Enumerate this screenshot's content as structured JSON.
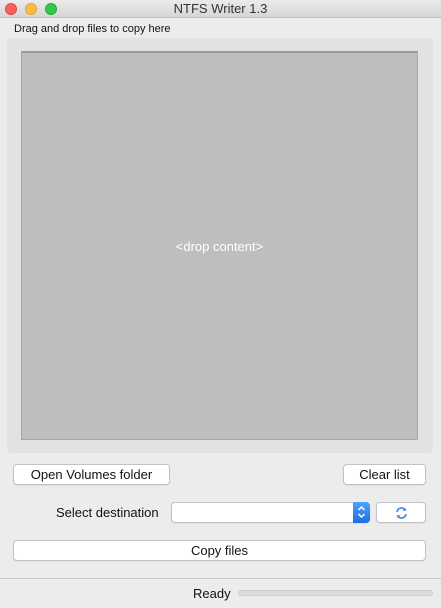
{
  "window": {
    "title": "NTFS Writer 1.3"
  },
  "drop": {
    "label": "Drag and drop files to copy here",
    "placeholder": "<drop content>"
  },
  "buttons": {
    "open_volumes": "Open Volumes folder",
    "clear_list": "Clear list",
    "copy_files": "Copy files",
    "refresh_icon": "refresh-icon"
  },
  "destination": {
    "label": "Select destination",
    "selected_value": ""
  },
  "status": {
    "text": "Ready",
    "progress": 0
  },
  "colors": {
    "accent": "#1a6fe8",
    "drop_area": "#bebebe"
  }
}
